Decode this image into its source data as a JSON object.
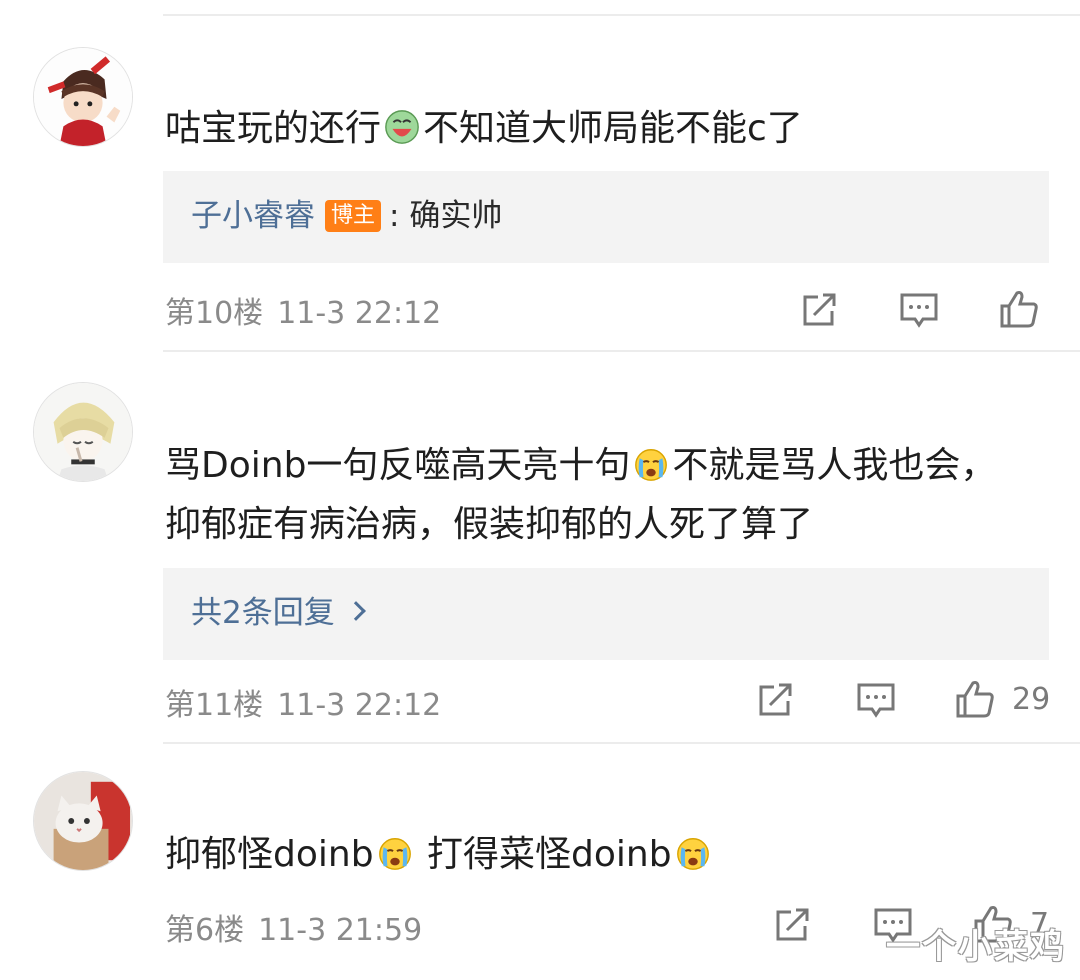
{
  "comments": [
    {
      "text_a": "咕宝玩的还行",
      "emoji_a": "happy-face-emoji",
      "text_b": "不知道大师局能不能c了",
      "reply": {
        "user": "子小睿睿",
        "badge": "博主",
        "text": ": 确实帅"
      },
      "floor": "第10楼",
      "time": "11-3 22:12",
      "likes": ""
    },
    {
      "line1_a": "骂Doinb一句反噬高天亮十句",
      "emoji_a": "crying-face-emoji",
      "line1_b": "不就是骂人我也会，",
      "line2": "抑郁症有病治病，假装抑郁的人死了算了",
      "reply_more": "共2条回复",
      "floor": "第11楼",
      "time": "11-3 22:12",
      "likes": "29"
    },
    {
      "text_a": "抑郁怪doinb",
      "emoji_a": "crying-face-emoji",
      "text_b": " 打得菜怪doinb",
      "emoji_b": "crying-face-emoji",
      "floor": "第6楼",
      "time": "11-3 21:59",
      "likes": "7"
    }
  ],
  "watermark": "一个小菜鸡",
  "colors": {
    "link": "#4e6f96",
    "badge": "#ff7f16",
    "reply_bg": "#f3f3f3",
    "meta": "#8a8a8a"
  }
}
